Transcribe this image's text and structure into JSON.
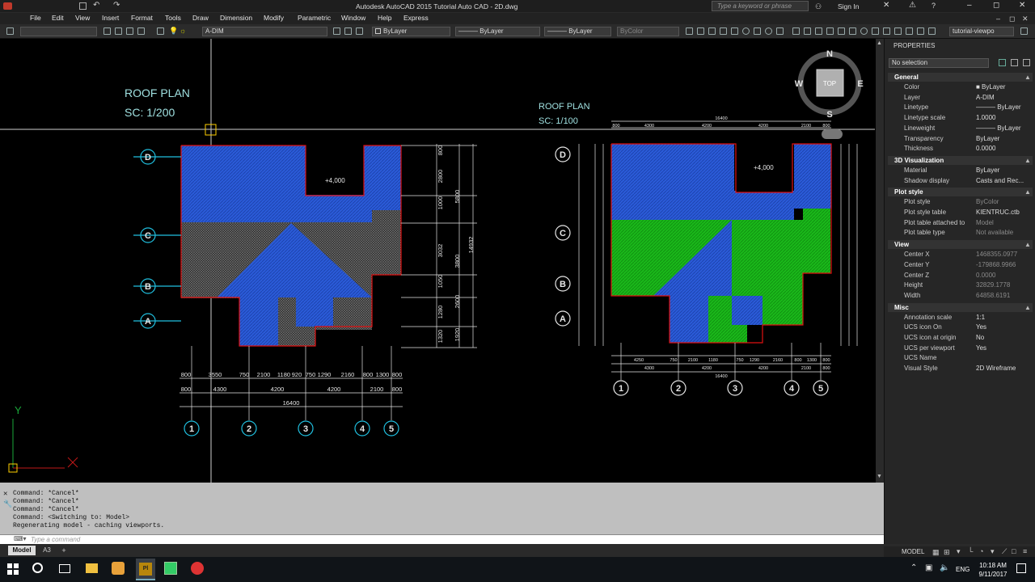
{
  "window": {
    "title": "Autodesk AutoCAD 2015   Tutorial Auto CAD - 2D.dwg",
    "search_placeholder": "Type a keyword or phrase",
    "sign_in": "Sign In"
  },
  "menu": [
    "File",
    "Edit",
    "View",
    "Insert",
    "Format",
    "Tools",
    "Draw",
    "Dimension",
    "Modify",
    "Parametric",
    "Window",
    "Help",
    "Express"
  ],
  "toolbar": {
    "layer": "A-DIM",
    "color": "ByLayer",
    "linetype": "ByLayer",
    "lineweight": "ByLayer",
    "plotstyle": "ByColor",
    "viewport": "tutorial-viewpo"
  },
  "viewcube": {
    "n": "N",
    "s": "S",
    "e": "E",
    "w": "W",
    "top": "TOP"
  },
  "drawing": {
    "left_title": "ROOF PLAN",
    "left_scale": "SC: 1/200",
    "right_title": "ROOF PLAN",
    "right_scale": "SC: 1/100",
    "level": "+4,000",
    "grid_rows": [
      "D",
      "C",
      "B",
      "A"
    ],
    "grid_cols": [
      "1",
      "2",
      "3",
      "4",
      "5"
    ],
    "left_dims_row1": [
      "800",
      "3550",
      "750",
      "2100",
      "1180",
      "920",
      "750",
      "1290",
      "2160",
      "800",
      "1300",
      "800"
    ],
    "left_dims_row2": [
      "800",
      "4300",
      "4200",
      "4200",
      "2100",
      "800"
    ],
    "left_total": "16400",
    "left_vdims": [
      "800",
      "2800",
      "5800",
      "1000",
      "3032",
      "3800",
      "14932",
      "1050",
      "1280",
      "2600",
      "1920",
      "1320"
    ],
    "right_dims_top": [
      "800",
      "4300",
      "4200",
      "4200",
      "2100",
      "800"
    ],
    "right_total_top": "16400",
    "right_dims_bottom1": [
      "4250",
      "750",
      "2100",
      "1180",
      "750",
      "1290",
      "2160",
      "800",
      "1300",
      "800"
    ],
    "right_dims_bottom2": [
      "4300",
      "4200",
      "4200",
      "2100",
      "800"
    ],
    "right_total_bottom": "16400",
    "ucs_y": "Y"
  },
  "properties": {
    "title": "PROPERTIES",
    "selection": "No selection",
    "sections": [
      {
        "name": "General",
        "rows": [
          [
            "Color",
            "■ ByLayer",
            false
          ],
          [
            "Layer",
            "A-DIM",
            false
          ],
          [
            "Linetype",
            "——— ByLayer",
            false
          ],
          [
            "Linetype scale",
            "1.0000",
            false
          ],
          [
            "Lineweight",
            "——— ByLayer",
            false
          ],
          [
            "Transparency",
            "ByLayer",
            false
          ],
          [
            "Thickness",
            "0.0000",
            false
          ]
        ]
      },
      {
        "name": "3D Visualization",
        "rows": [
          [
            "Material",
            "ByLayer",
            false
          ],
          [
            "Shadow display",
            "Casts and Rec...",
            false
          ]
        ]
      },
      {
        "name": "Plot style",
        "rows": [
          [
            "Plot style",
            "ByColor",
            true
          ],
          [
            "Plot style table",
            "KIENTRUC.ctb",
            false
          ],
          [
            "Plot table attached to",
            "Model",
            true
          ],
          [
            "Plot table type",
            "Not available",
            true
          ]
        ]
      },
      {
        "name": "View",
        "rows": [
          [
            "Center X",
            "1468355.0977",
            true
          ],
          [
            "Center Y",
            "-179868.9966",
            true
          ],
          [
            "Center Z",
            "0.0000",
            true
          ],
          [
            "Height",
            "32829.1778",
            true
          ],
          [
            "Width",
            "64858.6191",
            true
          ]
        ]
      },
      {
        "name": "Misc",
        "rows": [
          [
            "Annotation scale",
            "1:1",
            false
          ],
          [
            "UCS icon On",
            "Yes",
            false
          ],
          [
            "UCS icon at origin",
            "No",
            false
          ],
          [
            "UCS per viewport",
            "Yes",
            false
          ],
          [
            "UCS Name",
            "",
            false
          ],
          [
            "Visual Style",
            "2D Wireframe",
            false
          ]
        ]
      }
    ]
  },
  "command": {
    "lines": [
      "Command: *Cancel*",
      "Command: *Cancel*",
      "Command: *Cancel*",
      "Command:  <Switching to: Model>",
      "Regenerating model - caching viewports."
    ],
    "placeholder": "Type a command"
  },
  "tabs": [
    "Model",
    "A3",
    "+"
  ],
  "status": {
    "model": "MODEL"
  },
  "taskbar": {
    "lang": "ENG",
    "time": "10:18 AM",
    "date": "9/11/2017"
  },
  "colors": {
    "canvas": "#000000",
    "blue_roof": "#2b5bd8",
    "green_roof": "#19c019",
    "red_outline": "#e01010",
    "cyan": "#20c0e0",
    "white": "#e6e6e6"
  }
}
